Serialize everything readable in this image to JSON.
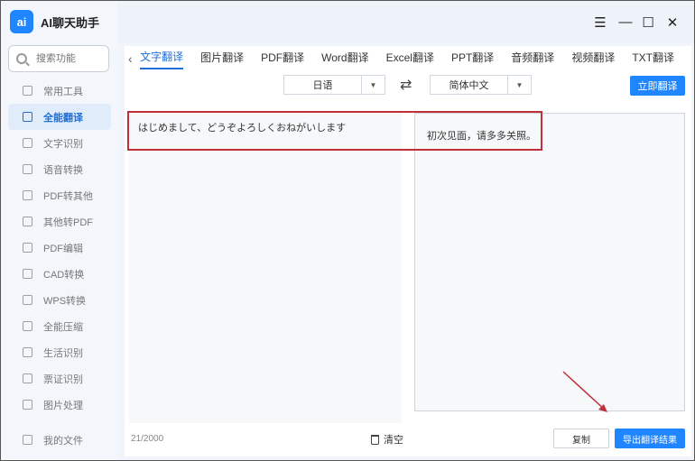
{
  "app": {
    "logo_text": "ai",
    "name": "AI聊天助手"
  },
  "search": {
    "placeholder": "搜索功能"
  },
  "sidebar": {
    "items": [
      {
        "label": "常用工具",
        "icon": "grid-icon"
      },
      {
        "label": "全能翻译",
        "icon": "translate-icon",
        "active": true
      },
      {
        "label": "文字识别",
        "icon": "text-scan-icon"
      },
      {
        "label": "语音转换",
        "icon": "voice-icon"
      },
      {
        "label": "PDF转其他",
        "icon": "pdf-icon"
      },
      {
        "label": "其他转PDF",
        "icon": "pdf-convert-icon"
      },
      {
        "label": "PDF编辑",
        "icon": "pdf-edit-icon"
      },
      {
        "label": "CAD转换",
        "icon": "cad-icon"
      },
      {
        "label": "WPS转换",
        "icon": "wps-icon"
      },
      {
        "label": "全能压缩",
        "icon": "compress-icon"
      },
      {
        "label": "生活识别",
        "icon": "life-scan-icon"
      },
      {
        "label": "票证识别",
        "icon": "ticket-icon"
      },
      {
        "label": "图片处理",
        "icon": "image-icon"
      }
    ],
    "bottom": {
      "label": "我的文件",
      "icon": "folder-icon"
    }
  },
  "window": {
    "menu": "☰",
    "minimize": "—",
    "maximize": "☐",
    "close": "✕"
  },
  "tabs": {
    "back": "‹",
    "items": [
      "文字翻译",
      "图片翻译",
      "PDF翻译",
      "Word翻译",
      "Excel翻译",
      "PPT翻译",
      "音频翻译",
      "视频翻译",
      "TXT翻译"
    ]
  },
  "lang": {
    "source": "日语",
    "target": "简体中文",
    "swap": "⇄",
    "translate_button": "立即翻译"
  },
  "source_text": "はじめまして、どうぞよろしくおねがいします",
  "target_text": "初次见面，请多多关照。",
  "footer": {
    "count": "21/2000",
    "clear": "清空",
    "copy": "复制",
    "export": "导出翻译结果"
  },
  "colors": {
    "accent": "#1f86ff",
    "annotation": "#c0303a"
  }
}
